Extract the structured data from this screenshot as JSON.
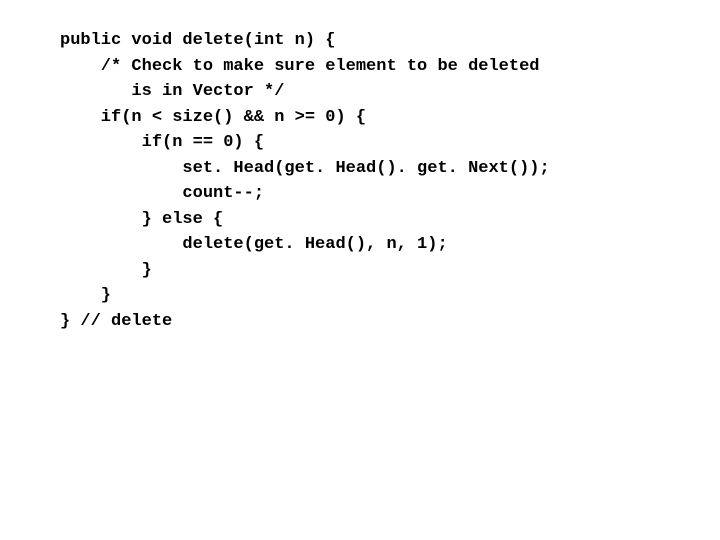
{
  "code": {
    "lines": [
      "public void delete(int n) {",
      "    /* Check to make sure element to be deleted",
      "       is in Vector */",
      "    if(n < size() && n >= 0) {",
      "        if(n == 0) {",
      "            set. Head(get. Head(). get. Next());",
      "            count--;",
      "        } else {",
      "            delete(get. Head(), n, 1);",
      "        }",
      "    }",
      "} // delete"
    ]
  }
}
